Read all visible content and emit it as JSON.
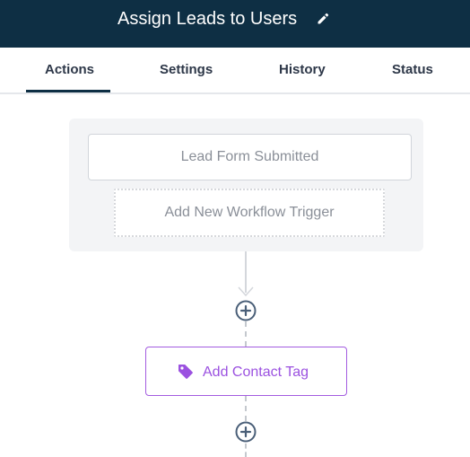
{
  "header": {
    "title": "Assign Leads to Users",
    "edit_icon": "pencil-icon",
    "background": "#0e2f44"
  },
  "tabs": [
    {
      "label": "Actions",
      "active": true
    },
    {
      "label": "Settings",
      "active": false
    },
    {
      "label": "History",
      "active": false
    },
    {
      "label": "Status",
      "active": false
    }
  ],
  "workflow": {
    "trigger": {
      "label": "Lead Form Submitted"
    },
    "add_trigger": {
      "label": "Add New Workflow Trigger"
    },
    "actions": [
      {
        "label": "Add Contact Tag",
        "icon": "tag-icon",
        "color": "#9b51e0"
      }
    ],
    "add_step_icon": "plus-circle-icon"
  }
}
